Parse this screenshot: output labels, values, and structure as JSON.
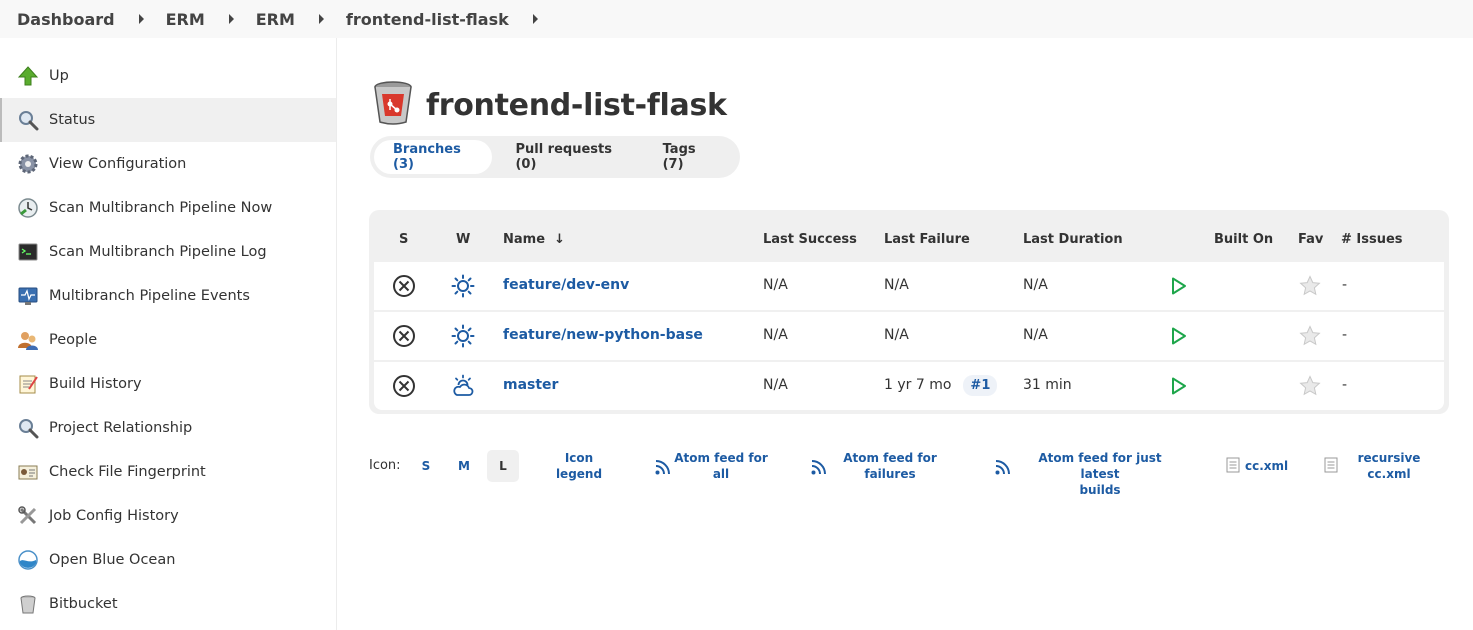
{
  "breadcrumb": [
    "Dashboard",
    "ERM",
    "ERM",
    "frontend-list-flask"
  ],
  "sidebar": {
    "items": [
      {
        "label": "Up",
        "icon": "up-arrow-icon"
      },
      {
        "label": "Status",
        "icon": "magnifier-icon"
      },
      {
        "label": "View Configuration",
        "icon": "gear-icon"
      },
      {
        "label": "Scan Multibranch Pipeline Now",
        "icon": "clock-scan-icon"
      },
      {
        "label": "Scan Multibranch Pipeline Log",
        "icon": "terminal-icon"
      },
      {
        "label": "Multibranch Pipeline Events",
        "icon": "monitor-pulse-icon"
      },
      {
        "label": "People",
        "icon": "people-icon"
      },
      {
        "label": "Build History",
        "icon": "notepad-icon"
      },
      {
        "label": "Project Relationship",
        "icon": "magnifier-icon"
      },
      {
        "label": "Check File Fingerprint",
        "icon": "fingerprint-card-icon"
      },
      {
        "label": "Job Config History",
        "icon": "tools-icon"
      },
      {
        "label": "Open Blue Ocean",
        "icon": "blue-ocean-icon"
      },
      {
        "label": "Bitbucket",
        "icon": "bucket-icon"
      }
    ],
    "active": "Status"
  },
  "page": {
    "title": "frontend-list-flask",
    "icon": "bitbucket-repo-icon"
  },
  "tabs": [
    {
      "label": "Branches (3)",
      "active": true
    },
    {
      "label": "Pull requests (0)",
      "active": false
    },
    {
      "label": "Tags (7)",
      "active": false
    }
  ],
  "table": {
    "headers": {
      "s": "S",
      "w": "W",
      "name": "Name",
      "sort": "↓",
      "last_success": "Last Success",
      "last_failure": "Last Failure",
      "last_duration": "Last Duration",
      "built_on": "Built On",
      "fav": "Fav",
      "issues": "# Issues"
    },
    "rows": [
      {
        "name": "feature/dev-env",
        "weather": "sunny-icon",
        "last_success": "N/A",
        "last_failure": "N/A",
        "failure_build": "",
        "last_duration": "N/A",
        "issues": "-"
      },
      {
        "name": "feature/new-python-base",
        "weather": "sunny-icon",
        "last_success": "N/A",
        "last_failure": "N/A",
        "failure_build": "",
        "last_duration": "N/A",
        "issues": "-"
      },
      {
        "name": "master",
        "weather": "cloudy-icon",
        "last_success": "N/A",
        "last_failure": "1 yr 7 mo",
        "failure_build": "#1",
        "last_duration": "31 min",
        "issues": "-"
      }
    ]
  },
  "footer": {
    "icon_label": "Icon:",
    "sizes": [
      "S",
      "M",
      "L"
    ],
    "active_size": "L",
    "links": {
      "legend": [
        "Icon",
        "legend"
      ],
      "atom_all": [
        "Atom feed for",
        "all"
      ],
      "atom_failures": [
        "Atom feed for",
        "failures"
      ],
      "atom_latest": [
        "Atom feed for just latest",
        "builds"
      ],
      "ccxml": "cc.xml",
      "recursive": [
        "recursive",
        "cc.xml"
      ]
    }
  },
  "colors": {
    "link": "#1d5ba3",
    "run_green": "#1ea64b",
    "sidebar_active": "#f0f0f0"
  }
}
